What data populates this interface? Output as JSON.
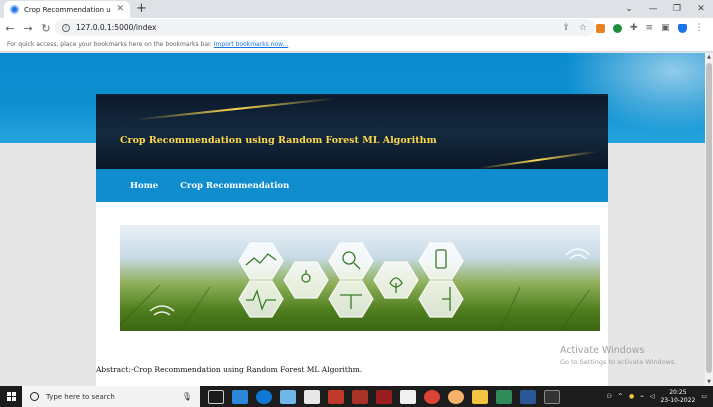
{
  "browser": {
    "tab_title": "Crop Recommendation using Ra",
    "url": "127.0.0.1:5000/index",
    "bookmarks_prompt": "For quick access, place your bookmarks here on the bookmarks bar.",
    "bookmarks_link": "Import bookmarks now..."
  },
  "page": {
    "site_title": "Crop Recommendation using Random Forest ML Algorithm",
    "nav": [
      {
        "label": "Home"
      },
      {
        "label": "Crop Recommendation"
      }
    ],
    "abstract": "Abstract:-Crop Recommendation using Random Forest ML Algorithm."
  },
  "watermark": {
    "title": "Activate Windows",
    "subtitle": "Go to Settings to activate Windows."
  },
  "taskbar": {
    "search_placeholder": "Type here to search",
    "time": "20:25",
    "date": "23-10-2022"
  },
  "colors": {
    "header_blue": "#0f8dcc",
    "title_gold": "#ffd84a",
    "banner_dark": "#0c1a2c"
  }
}
